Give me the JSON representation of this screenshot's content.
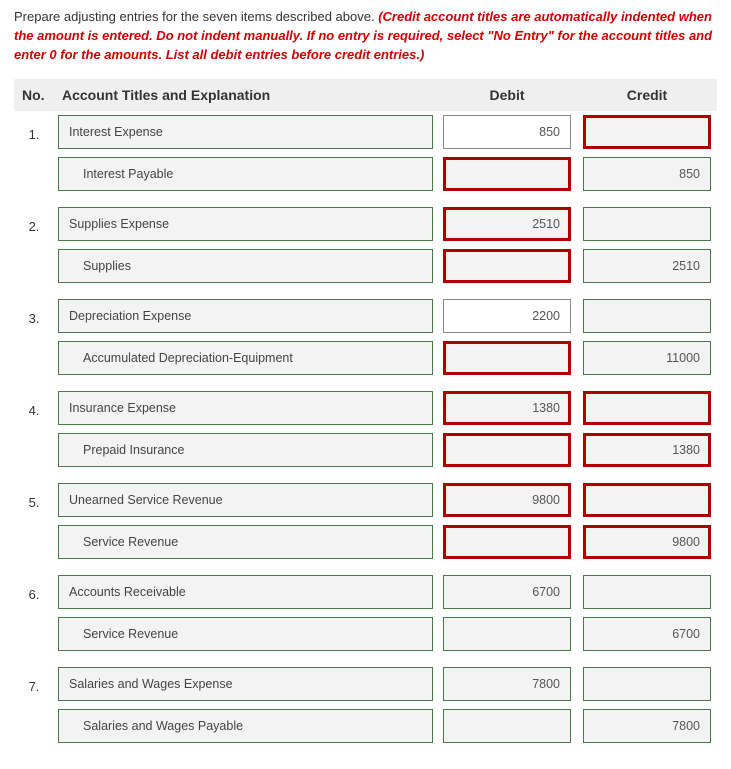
{
  "instructions": {
    "lead": "Prepare adjusting entries for the seven items described above. ",
    "italic": "(Credit account titles are automatically indented when the amount is entered. Do not indent manually. If no entry is required, select \"No Entry\" for the account titles and enter 0 for the amounts. List all debit entries before credit entries.)"
  },
  "headers": {
    "no": "No.",
    "account": "Account Titles and Explanation",
    "debit": "Debit",
    "credit": "Credit"
  },
  "entries": [
    {
      "no": "1.",
      "rows": [
        {
          "account": "Interest Expense",
          "indent": false,
          "debit": "850",
          "credit": "",
          "account_err": false,
          "debit_err": false,
          "debit_plain": true,
          "credit_err": true
        },
        {
          "account": "Interest Payable",
          "indent": true,
          "debit": "",
          "credit": "850",
          "account_err": false,
          "debit_err": true,
          "credit_err": false
        }
      ]
    },
    {
      "no": "2.",
      "rows": [
        {
          "account": "Supplies Expense",
          "indent": false,
          "debit": "2510",
          "credit": "",
          "account_err": false,
          "debit_err": true,
          "credit_err": false
        },
        {
          "account": "Supplies",
          "indent": true,
          "debit": "",
          "credit": "2510",
          "account_err": false,
          "debit_err": true,
          "credit_err": false
        }
      ]
    },
    {
      "no": "3.",
      "rows": [
        {
          "account": "Depreciation Expense",
          "indent": false,
          "debit": "2200",
          "credit": "",
          "account_err": false,
          "debit_err": false,
          "debit_plain": true,
          "credit_err": false
        },
        {
          "account": "Accumulated Depreciation-Equipment",
          "indent": true,
          "debit": "",
          "credit": "11000",
          "account_err": false,
          "debit_err": true,
          "credit_err": false
        }
      ]
    },
    {
      "no": "4.",
      "rows": [
        {
          "account": "Insurance Expense",
          "indent": false,
          "debit": "1380",
          "credit": "",
          "account_err": false,
          "debit_err": true,
          "credit_err": true
        },
        {
          "account": "Prepaid Insurance",
          "indent": true,
          "debit": "",
          "credit": "1380",
          "account_err": false,
          "debit_err": true,
          "credit_err": true
        }
      ]
    },
    {
      "no": "5.",
      "rows": [
        {
          "account": "Unearned Service Revenue",
          "indent": false,
          "debit": "9800",
          "credit": "",
          "account_err": false,
          "debit_err": true,
          "credit_err": true
        },
        {
          "account": "Service Revenue",
          "indent": true,
          "debit": "",
          "credit": "9800",
          "account_err": false,
          "debit_err": true,
          "credit_err": true
        }
      ]
    },
    {
      "no": "6.",
      "rows": [
        {
          "account": "Accounts Receivable",
          "indent": false,
          "debit": "6700",
          "credit": "",
          "account_err": false,
          "debit_err": false,
          "credit_err": false
        },
        {
          "account": "Service Revenue",
          "indent": true,
          "debit": "",
          "credit": "6700",
          "account_err": false,
          "debit_err": false,
          "credit_err": false
        }
      ]
    },
    {
      "no": "7.",
      "rows": [
        {
          "account": "Salaries and Wages Expense",
          "indent": false,
          "debit": "7800",
          "credit": "",
          "account_err": false,
          "debit_err": false,
          "credit_err": false
        },
        {
          "account": "Salaries and Wages Payable",
          "indent": true,
          "debit": "",
          "credit": "7800",
          "account_err": false,
          "debit_err": false,
          "credit_err": false
        }
      ]
    }
  ]
}
